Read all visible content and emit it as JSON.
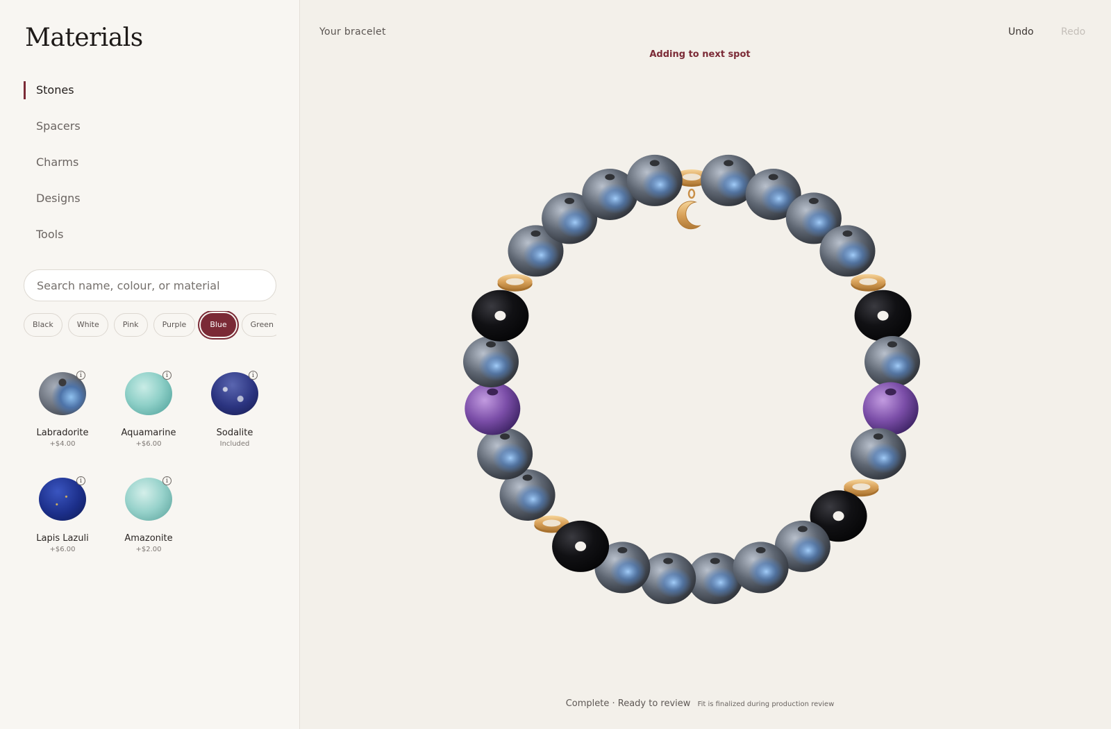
{
  "sidebar": {
    "title": "Materials",
    "nav": [
      {
        "label": "Stones",
        "active": true
      },
      {
        "label": "Spacers",
        "active": false
      },
      {
        "label": "Charms",
        "active": false
      },
      {
        "label": "Designs",
        "active": false
      },
      {
        "label": "Tools",
        "active": false
      }
    ],
    "search_placeholder": "Search name, colour, or material",
    "filters": [
      {
        "label": "Black",
        "selected": false
      },
      {
        "label": "White",
        "selected": false
      },
      {
        "label": "Pink",
        "selected": false
      },
      {
        "label": "Purple",
        "selected": false
      },
      {
        "label": "Blue",
        "selected": true
      },
      {
        "label": "Green",
        "selected": false
      }
    ],
    "stones": [
      {
        "name": "Labradorite",
        "price": "+$4.00",
        "icon": "labradorite-bead"
      },
      {
        "name": "Aquamarine",
        "price": "+$6.00",
        "icon": "aquamarine-bead"
      },
      {
        "name": "Sodalite",
        "price": "Included",
        "icon": "sodalite-bead"
      },
      {
        "name": "Lapis Lazuli",
        "price": "+$6.00",
        "icon": "lapis-lazuli-bead"
      },
      {
        "name": "Amazonite",
        "price": "+$2.00",
        "icon": "amazonite-bead"
      }
    ],
    "info_glyph": "i"
  },
  "main": {
    "title": "Your bracelet",
    "undo": "Undo",
    "redo": "Redo",
    "status": "Adding to next spot",
    "footer_status": "Complete · Ready to review",
    "footer_note": "Fit is finalized during production review"
  },
  "bracelet": {
    "sequence": [
      "labradorite",
      "labradorite",
      "labradorite",
      "onyx",
      "gold-spacer",
      "labradorite",
      "labradorite",
      "amethyst",
      "labradorite",
      "onyx",
      "gold-spacer",
      "labradorite",
      "labradorite",
      "labradorite",
      "labradorite",
      "gold-spacer",
      "labradorite",
      "labradorite",
      "labradorite",
      "labradorite",
      "gold-spacer",
      "onyx",
      "labradorite",
      "amethyst",
      "labradorite",
      "gold-spacer",
      "onyx",
      "labradorite",
      "labradorite"
    ],
    "charm": "moon-charm"
  },
  "colors": {
    "accent": "#7b2a36",
    "labradorite": "#6f82a0",
    "onyx": "#0e0d10",
    "amethyst": "#7c4fa6",
    "gold": "#d9a25a"
  }
}
